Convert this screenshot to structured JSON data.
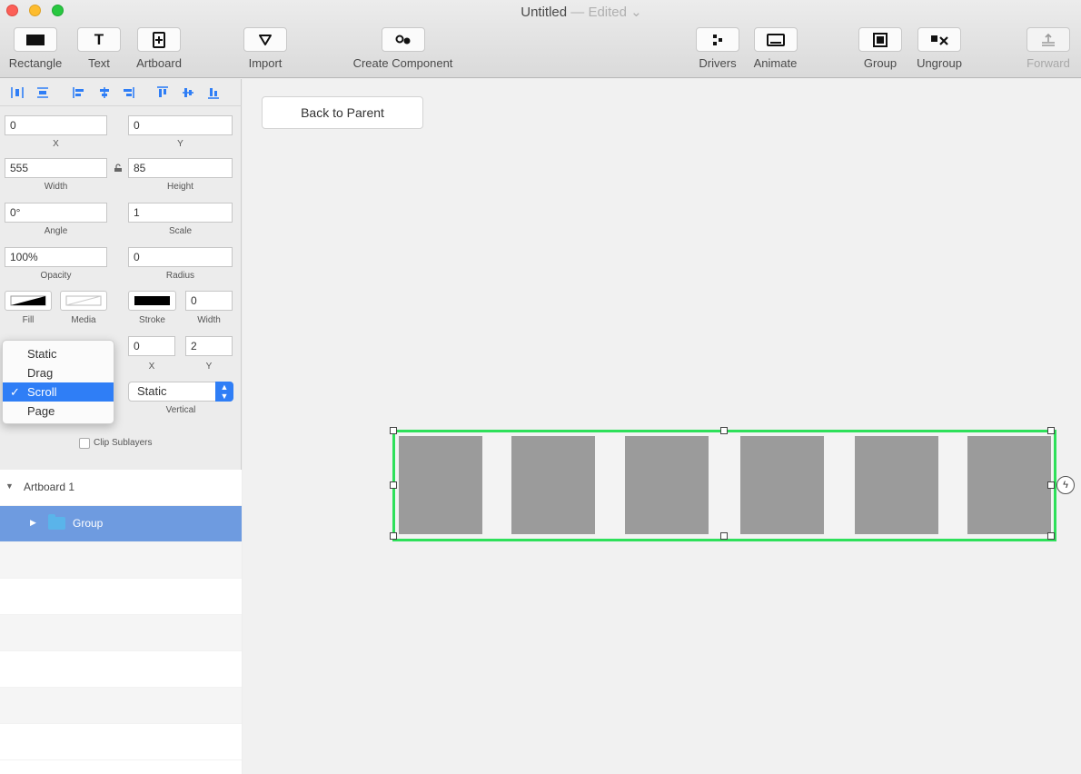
{
  "window": {
    "title": "Untitled",
    "separator": "—",
    "status": "Edited",
    "status_chevron": "⌄"
  },
  "toolbar": {
    "rectangle": "Rectangle",
    "text": "Text",
    "text_glyph": "T",
    "artboard": "Artboard",
    "import": "Import",
    "create_component": "Create Component",
    "drivers": "Drivers",
    "animate": "Animate",
    "group": "Group",
    "ungroup": "Ungroup",
    "forward": "Forward"
  },
  "inspector": {
    "x": {
      "value": "0",
      "label": "X"
    },
    "y": {
      "value": "0",
      "label": "Y"
    },
    "width": {
      "value": "555",
      "label": "Width"
    },
    "height": {
      "value": "85",
      "label": "Height"
    },
    "angle": {
      "value": "0°",
      "label": "Angle"
    },
    "scale": {
      "value": "1",
      "label": "Scale"
    },
    "opacity": {
      "value": "100%",
      "label": "Opacity"
    },
    "radius": {
      "value": "0",
      "label": "Radius"
    },
    "fill_label": "Fill",
    "media_label": "Media",
    "stroke_label": "Stroke",
    "stroke_width": {
      "value": "0",
      "label": "Width"
    },
    "shadow_x": {
      "value": "0",
      "label": "X"
    },
    "shadow_y": {
      "value": "2",
      "label": "Y"
    },
    "vertical": {
      "value": "Static",
      "label": "Vertical"
    },
    "clip_sublayers": "Clip Sublayers"
  },
  "behavior_menu": {
    "items": [
      "Static",
      "Drag",
      "Scroll",
      "Page"
    ],
    "selected": "Scroll",
    "check": "✓"
  },
  "layers": {
    "artboard": "Artboard 1",
    "group": "Group"
  },
  "canvas": {
    "back_to_parent": "Back to Parent"
  },
  "colors": {
    "selection_outline": "#2ee05a",
    "accent": "#2f7ef6",
    "layer_selected": "#6e9be0",
    "tile": "#9b9b9b"
  }
}
